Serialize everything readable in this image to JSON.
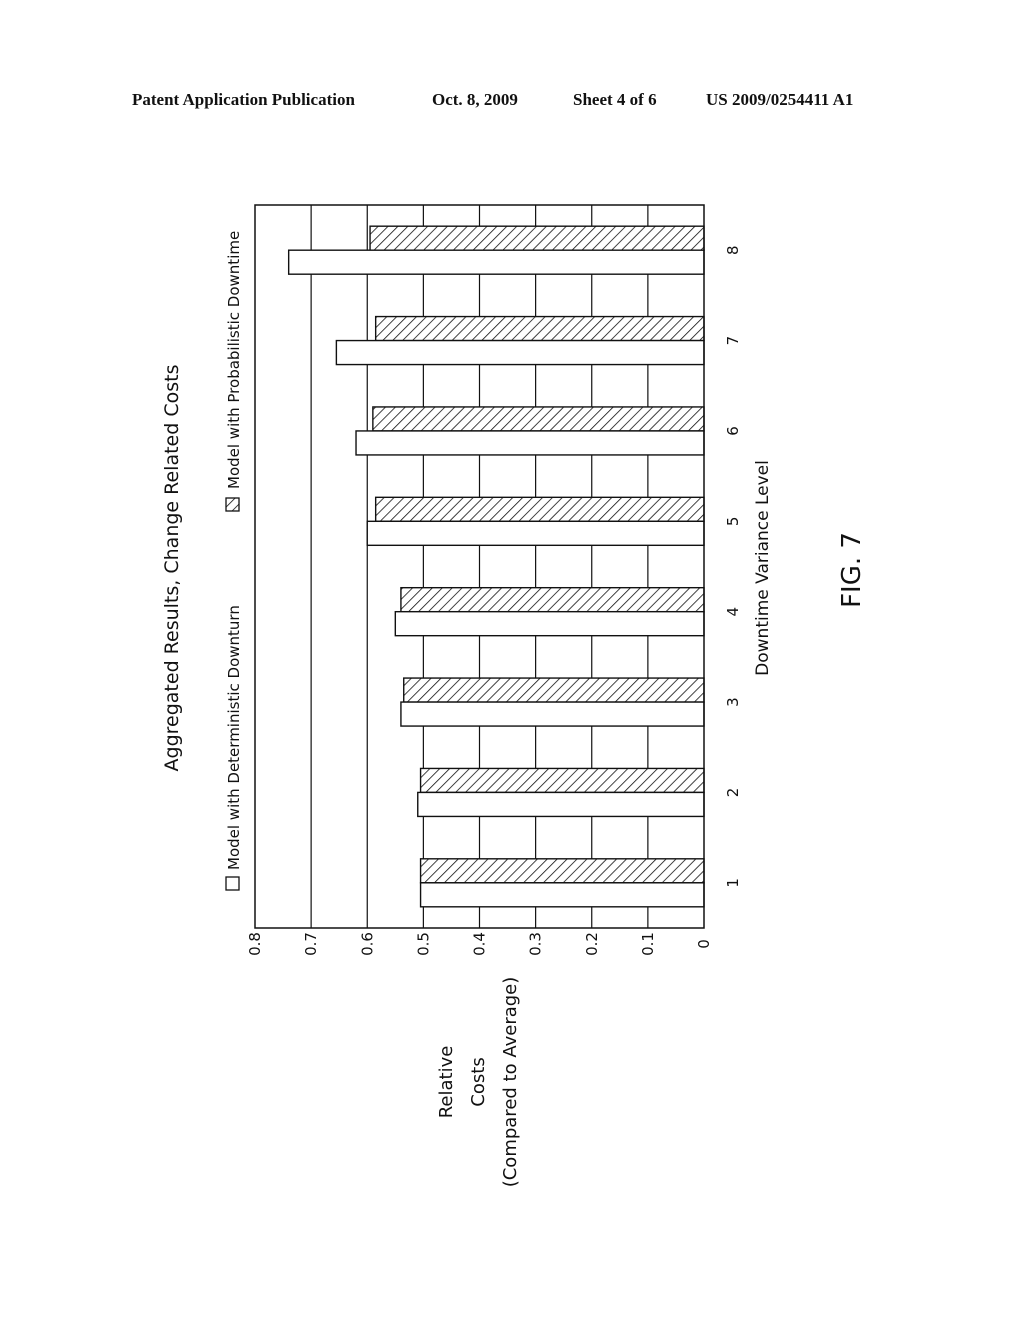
{
  "header": {
    "left": "Patent Application Publication",
    "date": "Oct. 8, 2009",
    "sheet": "Sheet 4 of 6",
    "number": "US 2009/0254411 A1"
  },
  "figure_label": "FIG. 7",
  "chart_data": {
    "type": "bar",
    "orientation": "rotated-90-ccw",
    "title": "Aggregated Results, Change Related Costs",
    "xlabel": "Downtime Variance Level",
    "ylabel": "Relative Costs (Compared to Average)",
    "ylabel_lines": [
      "Relative",
      "Costs",
      "(Compared to Average)"
    ],
    "categories": [
      "1",
      "2",
      "3",
      "4",
      "5",
      "6",
      "7",
      "8"
    ],
    "series": [
      {
        "name": "Model with Deterministic Downturn",
        "pattern": "white",
        "values": [
          0.505,
          0.51,
          0.54,
          0.55,
          0.6,
          0.62,
          0.655,
          0.74
        ]
      },
      {
        "name": "Model with Probabilistic Downtime",
        "pattern": "hatched",
        "values": [
          0.505,
          0.505,
          0.535,
          0.54,
          0.585,
          0.59,
          0.585,
          0.595
        ]
      }
    ],
    "ylim": [
      0,
      0.8
    ],
    "yticks": [
      0,
      0.1,
      0.2,
      0.3,
      0.4,
      0.5,
      0.6,
      0.7,
      0.8
    ],
    "ytick_labels": [
      "0",
      "0.1",
      "0.2",
      "0.3",
      "0.4",
      "0.5",
      "0.6",
      "0.7",
      "0.8"
    ],
    "grid": true,
    "legend": {
      "placement": "top",
      "entries": [
        {
          "label": "Model with Deterministic Downturn",
          "symbol": "empty-square"
        },
        {
          "label": "Model with Probabilistic Downtime",
          "symbol": "hatched-square"
        }
      ]
    },
    "colors": {
      "ink": "#111111",
      "background": "#ffffff"
    }
  }
}
